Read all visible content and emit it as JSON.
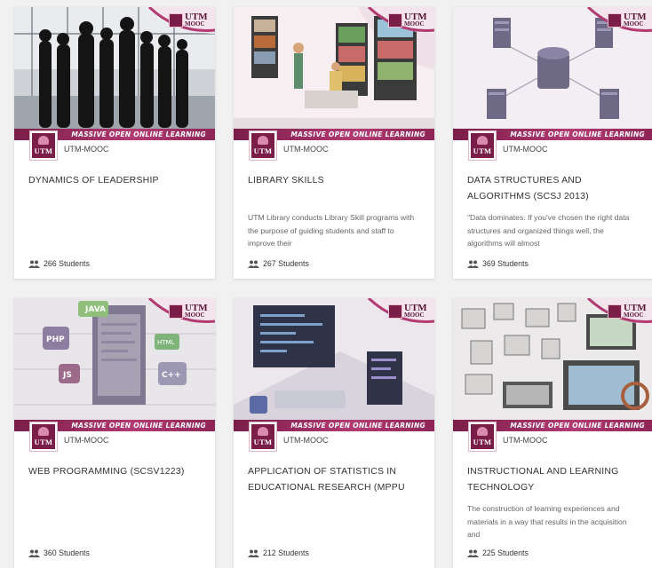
{
  "ribbon_text": "MASSIVE OPEN ONLINE LEARNING",
  "badge_lines": [
    "UTM",
    "MOOC"
  ],
  "colors": {
    "brand": "#7a1e49",
    "accent": "#b23a72",
    "page_bg": "#f1f1f1"
  },
  "courses": [
    {
      "provider": "UTM-MOOC",
      "logo_text": "UTM",
      "title": "DYNAMICS OF LEADERSHIP",
      "description": "",
      "students": "266 Students",
      "image": "leadership-silhouettes"
    },
    {
      "provider": "UTM-MOOC",
      "logo_text": "UTM",
      "title": "LIBRARY SKILLS",
      "description": "UTM Library conducts Library Skill programs with the purpose of guiding students and staff to improve their",
      "students": "267 Students",
      "image": "library-illustration"
    },
    {
      "provider": "UTM-MOOC",
      "logo_text": "UTM",
      "title": "DATA STRUCTURES AND ALGORITHMS (SCSJ 2013)",
      "description": "\"Data dominates. If you've chosen the right data structures and organized things well, the algorithms will almost",
      "students": "369 Students",
      "image": "database-isometric"
    },
    {
      "provider": "UTM-MOOC",
      "logo_text": "UTM",
      "title": "WEB PROGRAMMING (SCSV1223)",
      "description": "",
      "students": "360 Students",
      "image": "programming-languages"
    },
    {
      "provider": "UTM-MOOC",
      "logo_text": "UTM",
      "title": "APPLICATION OF STATISTICS IN EDUCATIONAL RESEARCH (MPPU",
      "description": "",
      "students": "212 Students",
      "image": "coding-workstation"
    },
    {
      "provider": "UTM-MOOC",
      "logo_text": "UTM",
      "title": "INSTRUCTIONAL AND LEARNING TECHNOLOGY",
      "description": "The construction of learning experiences and materials in a way that results in the acquisition and",
      "students": "225 Students",
      "image": "learning-devices"
    }
  ]
}
